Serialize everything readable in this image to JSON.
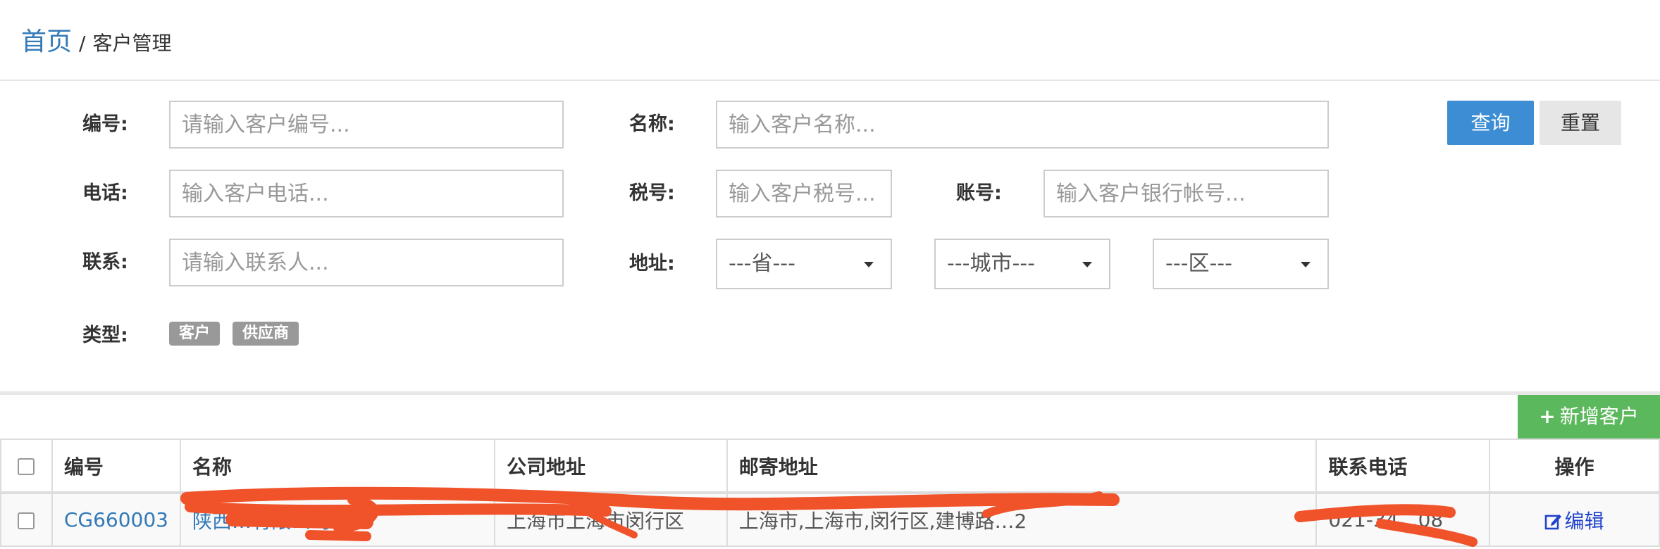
{
  "breadcrumb": {
    "home": "首页",
    "separator": "/",
    "current": "客户管理"
  },
  "filters": {
    "code": {
      "label": "编号:",
      "placeholder": "请输入客户编号..."
    },
    "name": {
      "label": "名称:",
      "placeholder": "输入客户名称..."
    },
    "phone": {
      "label": "电话:",
      "placeholder": "输入客户电话..."
    },
    "tax": {
      "label": "税号:",
      "placeholder": "输入客户税号..."
    },
    "account": {
      "label": "账号:",
      "placeholder": "输入客户银行帐号..."
    },
    "contact": {
      "label": "联系:",
      "placeholder": "请输入联系人..."
    },
    "address": {
      "label": "地址:",
      "province": "---省---",
      "city": "---城市---",
      "district": "---区---"
    },
    "type": {
      "label": "类型:",
      "options": [
        "客户",
        "供应商"
      ]
    }
  },
  "actions": {
    "query": "查询",
    "reset": "重置",
    "add_plus": "+",
    "add": "新增客户"
  },
  "table": {
    "headers": [
      "编号",
      "名称",
      "公司地址",
      "邮寄地址",
      "联系电话",
      "操作"
    ],
    "rows": [
      {
        "code": "CG660003",
        "name": "陕西…有限公司",
        "company_address": "上海市上海市闵行区",
        "mail_address": "上海市,上海市,闵行区,建博路…2",
        "phone": "021-34…08",
        "action_icon": "edit-icon",
        "action": "编辑"
      }
    ]
  },
  "colors": {
    "primary": "#3c8dd4",
    "success": "#5cb85c",
    "link": "#337ab7",
    "redaction": "#f0522a"
  }
}
